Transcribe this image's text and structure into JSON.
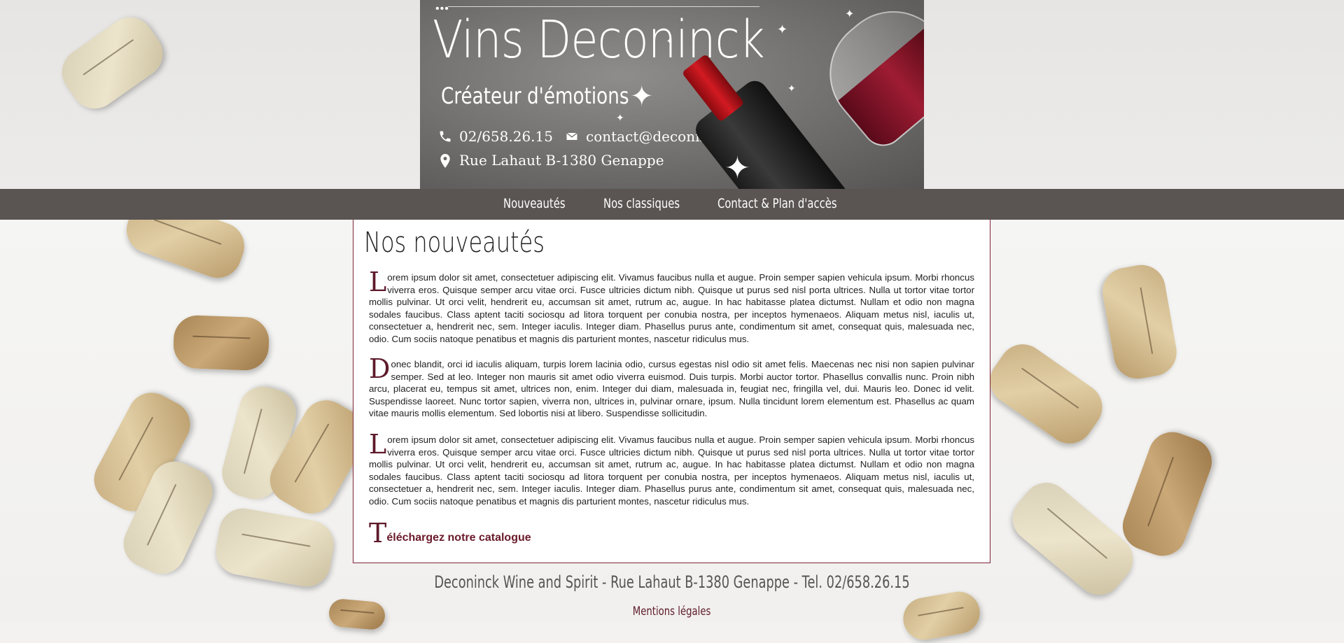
{
  "header": {
    "title": "Vins Deconinck",
    "subtitle": "Créateur d'émotions",
    "phone": "02/658.26.15",
    "email": "contact@deconinck.be",
    "address": "Rue Lahaut B-1380 Genappe",
    "icons": [
      "phone-icon",
      "mail-icon",
      "location-pin-icon"
    ]
  },
  "nav": {
    "items": [
      {
        "label": "Nouveautés"
      },
      {
        "label": "Nos classiques"
      },
      {
        "label": "Contact & Plan d'accès"
      }
    ]
  },
  "main": {
    "heading": "Nos nouveautés",
    "paragraphs": [
      {
        "initial": "L",
        "text": "orem ipsum dolor sit amet, consectetuer adipiscing elit. Vivamus faucibus nulla et augue. Proin semper sapien vehicula ipsum. Morbi rhoncus viverra eros. Quisque semper arcu vitae orci. Fusce ultricies dictum nibh. Quisque ut purus sed nisl porta ultrices. Nulla ut tortor vitae tortor mollis pulvinar. Ut orci velit, hendrerit eu, accumsan sit amet, rutrum ac, augue. In hac habitasse platea dictumst. Nullam et odio non magna sodales faucibus. Class aptent taciti sociosqu ad litora torquent per conubia nostra, per inceptos hymenaeos. Aliquam metus nisl, iaculis ut, consectetuer a, hendrerit nec, sem. Integer iaculis. Integer diam. Phasellus purus ante, condimentum sit amet, consequat quis, malesuada nec, odio. Cum sociis natoque penatibus et magnis dis parturient montes, nascetur ridiculus mus."
      },
      {
        "initial": "D",
        "text": "onec blandit, orci id iaculis aliquam, turpis lorem lacinia odio, cursus egestas nisl odio sit amet felis. Maecenas nec nisi non sapien pulvinar semper. Sed at leo. Integer non mauris sit amet odio viverra euismod. Duis turpis. Morbi auctor tortor. Phasellus convallis nunc. Proin nibh arcu, placerat eu, tempus sit amet, ultrices non, enim. Integer dui diam, malesuada in, feugiat nec, fringilla vel, dui. Mauris leo. Donec id velit. Suspendisse laoreet. Nunc tortor sapien, viverra non, ultrices in, pulvinar ornare, ipsum. Nulla tincidunt lorem elementum est. Phasellus ac quam vitae mauris mollis elementum. Sed lobortis nisi at libero. Suspendisse sollicitudin."
      },
      {
        "initial": "L",
        "text": "orem ipsum dolor sit amet, consectetuer adipiscing elit. Vivamus faucibus nulla et augue. Proin semper sapien vehicula ipsum. Morbi rhoncus viverra eros. Quisque semper arcu vitae orci. Fusce ultricies dictum nibh. Quisque ut purus sed nisl porta ultrices. Nulla ut tortor vitae tortor mollis pulvinar. Ut orci velit, hendrerit eu, accumsan sit amet, rutrum ac, augue. In hac habitasse platea dictumst. Nullam et odio non magna sodales faucibus. Class aptent taciti sociosqu ad litora torquent per conubia nostra, per inceptos hymenaeos. Aliquam metus nisl, iaculis ut, consectetuer a, hendrerit nec, sem. Integer iaculis. Integer diam. Phasellus purus ante, condimentum sit amet, consequat quis, malesuada nec, odio. Cum sociis natoque penatibus et magnis dis parturient montes, nascetur ridiculus mus."
      }
    ],
    "download": {
      "initial": "T",
      "label": "éléchargez notre catalogue"
    }
  },
  "footer": {
    "text": "Deconinck Wine and Spirit - Rue Lahaut B-1380 Genappe - Tel. 02/658.26.15",
    "legal_label": "Mentions légales"
  },
  "colors": {
    "accent": "#5e1a2b",
    "nav_bg": "#5a5553",
    "content_border": "#7c2434"
  }
}
